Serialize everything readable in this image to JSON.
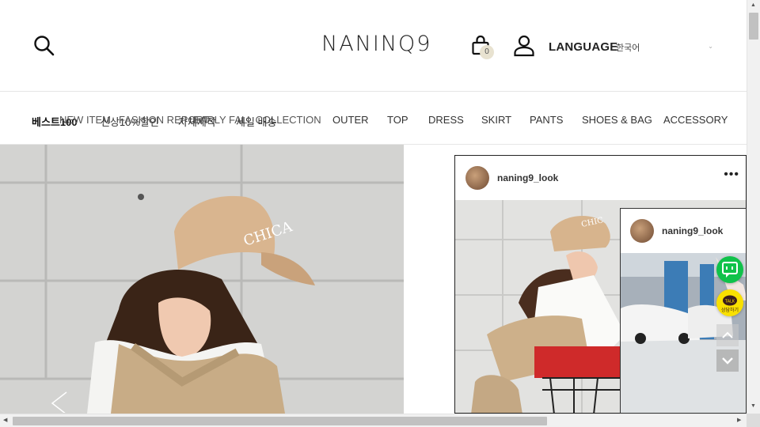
{
  "header": {
    "logo": "NANINQ9",
    "cart_count": "0",
    "language_label": "LANGUAGE",
    "language_value": "한국어",
    "icons": {
      "search": "search-icon",
      "cart": "shopping-bag-icon",
      "account": "user-icon"
    }
  },
  "nav": {
    "items": [
      {
        "label": "베스트100",
        "style": "bold"
      },
      {
        "label": "NEW ITEM",
        "style": "ghost"
      },
      {
        "label": "신상10%할인",
        "style": "normal"
      },
      {
        "label": "FASHION REPORT",
        "style": "ghost"
      },
      {
        "label": "자체제작",
        "style": "normal"
      },
      {
        "label": "EARLY FALL COLLECTION",
        "style": "ghost"
      },
      {
        "label": "세일 배송",
        "style": "normal"
      },
      {
        "label": "OUTER",
        "style": "normal"
      },
      {
        "label": "TOP",
        "style": "normal"
      },
      {
        "label": "DRESS",
        "style": "normal"
      },
      {
        "label": "SKIRT",
        "style": "normal"
      },
      {
        "label": "PANTS",
        "style": "normal"
      },
      {
        "label": "SHOES & BAG",
        "style": "normal"
      },
      {
        "label": "ACCESSORY",
        "style": "normal"
      }
    ]
  },
  "hero": {
    "cap_text": "CHICA"
  },
  "instagram": {
    "username": "naning9_look",
    "more": "•••",
    "secondary_username": "naning9_look",
    "cap_text": "CHIC"
  },
  "floating": {
    "talk_icon": "talk-chat-icon",
    "kakao_label": "상담하기",
    "kakao_color": "#f9e000",
    "talk_color": "#10c24a"
  }
}
